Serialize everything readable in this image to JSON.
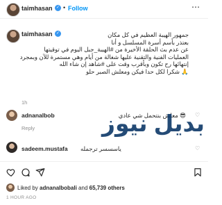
{
  "header": {
    "username": "taimhasan",
    "verified_glyph": "✓",
    "separator": "•",
    "follow_label": "Follow",
    "more_icon": "⋯"
  },
  "caption": {
    "username": "taimhasan",
    "lines": [
      "جمهور الهيبة العظيم في كل مكان",
      "بعتذر بأسم أسرة المسلسل و أنا",
      "عن عدم بث الحلقة الأخيرة من #الهيبة_جبل اليوم في توقيتها",
      "العمليات الفنية والتقنية عليها شغالة من أيام وهي مستمرة للآن وبمجرد",
      "إنتهائها رح تكون وبأقرب وقت على #شاهد إن شاء الله",
      "🙏 شكرا لكل حدا فيكن ومعلش الصبر حلو"
    ],
    "time": "1h"
  },
  "comments": [
    {
      "username": "adnanalbob",
      "text": "😎 معلش بنتحمل شي عادي",
      "reply_label": "Reply"
    },
    {
      "username": "sadeem.mustafa",
      "text": "ياسسسر ترجمله"
    }
  ],
  "watermark": "بديل نيوز",
  "likes": {
    "prefix": "Liked by ",
    "user": "adnanalbobali",
    "middle": " and ",
    "count": "65,739 others"
  },
  "post_time": "1 HOUR AGO",
  "colors": {
    "accent": "#0095f6",
    "verified": "#3897f0",
    "watermark": "#123c6b",
    "muted": "#8e8e8e"
  }
}
